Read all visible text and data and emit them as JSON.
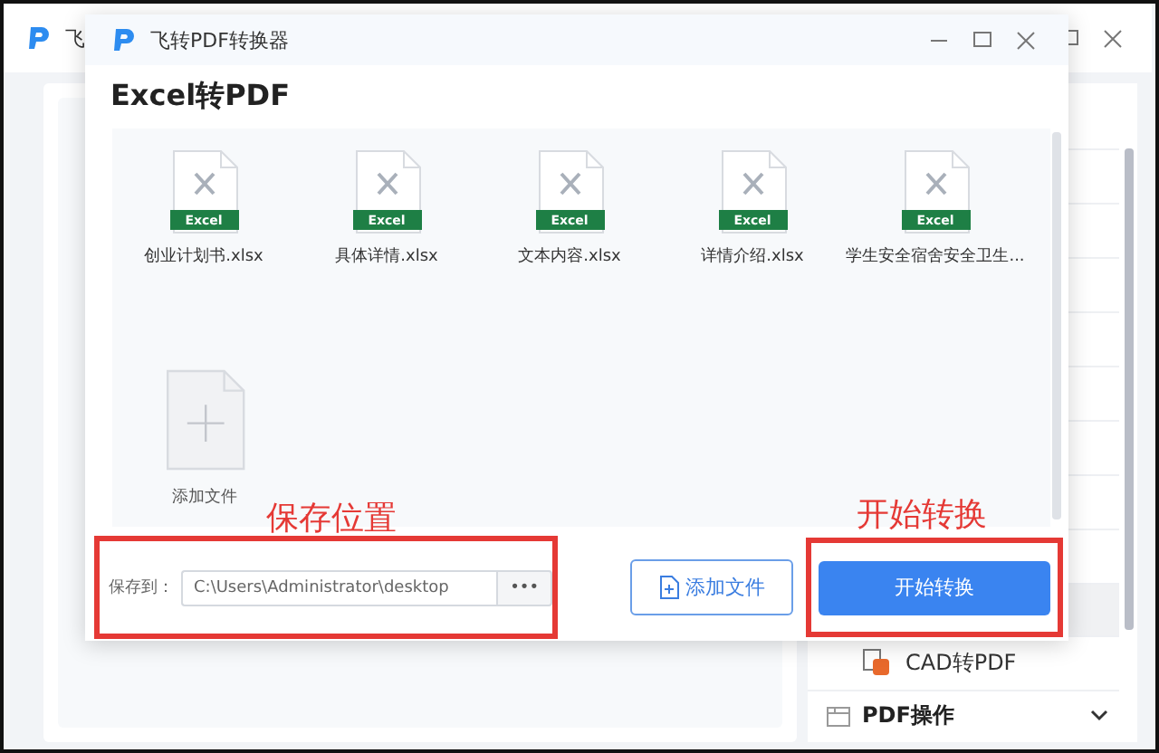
{
  "background_window": {
    "title": "飞",
    "side_items": [
      {
        "label": "CAD转PDF"
      }
    ],
    "side_section": {
      "label": "PDF操作",
      "expanded": false
    }
  },
  "dialog": {
    "title": "飞转PDF转换器",
    "heading": "Excel转PDF",
    "files": [
      {
        "name": "创业计划书.xlsx",
        "badge": "Excel"
      },
      {
        "name": "具体详情.xlsx",
        "badge": "Excel"
      },
      {
        "name": "文本内容.xlsx",
        "badge": "Excel"
      },
      {
        "name": "详情介绍.xlsx",
        "badge": "Excel"
      },
      {
        "name": "学生安全宿舍安全卫生...",
        "badge": "Excel"
      }
    ],
    "add_tile": {
      "label": "添加文件"
    },
    "save": {
      "label": "保存到：",
      "path": "C:\\Users\\Administrator\\desktop",
      "browse": "•••"
    },
    "add_button": "添加文件",
    "start_button": "开始转换"
  },
  "annotations": [
    {
      "text": "保存位置"
    },
    {
      "text": "开始转换"
    }
  ]
}
